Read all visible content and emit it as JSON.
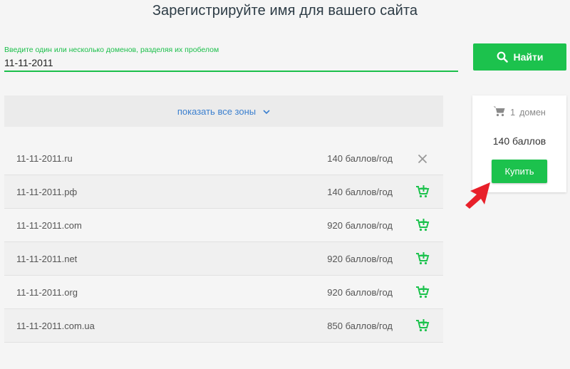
{
  "page": {
    "title": "Зарегистрируйте имя для вашего сайта"
  },
  "search": {
    "label": "Введите один или несколько доменов, разделяя их пробелом",
    "value": "11-11-2011",
    "button_label": "Найти",
    "button_icon": "search-icon"
  },
  "zones": {
    "toggle_label": "показать все зоны",
    "toggle_icon": "chevron-down-icon"
  },
  "domains": [
    {
      "name": "11-11-2011.ru",
      "price": "140 баллов/год",
      "action_icon": "close-icon"
    },
    {
      "name": "11-11-2011.рф",
      "price": "140 баллов/год",
      "action_icon": "add-to-cart-icon"
    },
    {
      "name": "11-11-2011.com",
      "price": "920 баллов/год",
      "action_icon": "add-to-cart-icon"
    },
    {
      "name": "11-11-2011.net",
      "price": "920 баллов/год",
      "action_icon": "add-to-cart-icon"
    },
    {
      "name": "11-11-2011.org",
      "price": "920 баллов/год",
      "action_icon": "add-to-cart-icon"
    },
    {
      "name": "11-11-2011.com.ua",
      "price": "850 баллов/год",
      "action_icon": "add-to-cart-icon"
    }
  ],
  "cart": {
    "count": "1",
    "count_label": "домен",
    "total": "140 баллов",
    "buy_label": "Купить",
    "icon": "cart-icon"
  },
  "colors": {
    "accent_green": "#1cc24d",
    "link_blue": "#3a7fcf",
    "arrow_red": "#e8202a"
  }
}
